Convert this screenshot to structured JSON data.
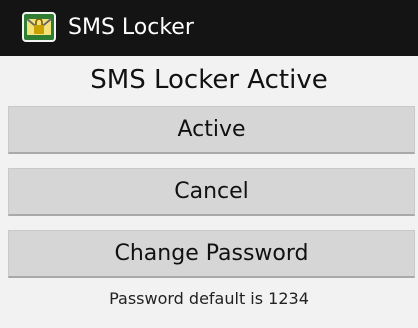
{
  "action_bar": {
    "title": "SMS Locker",
    "icon": "sms-locker-app-icon"
  },
  "main": {
    "title": "SMS Locker Active",
    "buttons": {
      "active_label": "Active",
      "cancel_label": "Cancel",
      "change_password_label": "Change Password"
    },
    "hint": "Password default is 1234"
  },
  "colors": {
    "action_bar_bg": "#141414",
    "content_bg": "#f2f2f2",
    "button_bg": "#d6d6d6"
  }
}
